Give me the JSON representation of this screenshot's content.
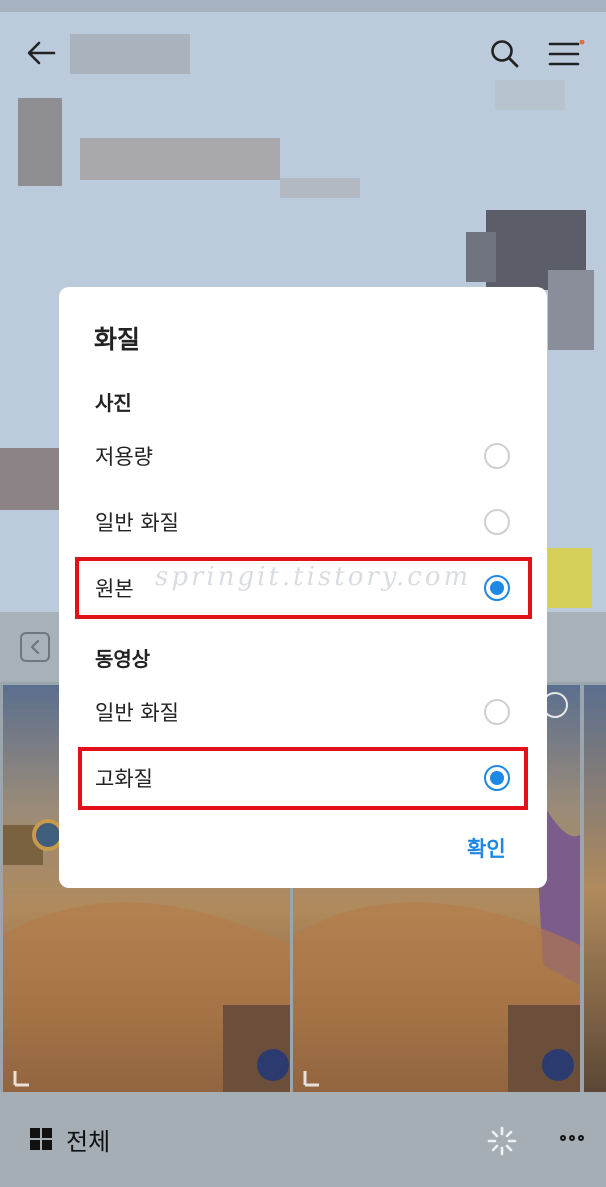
{
  "header": {
    "back_icon": "arrow-left-icon",
    "search_icon": "search-icon",
    "menu_icon": "hamburger-menu-icon",
    "notification_dot_color": "#e66a3c"
  },
  "dialog": {
    "title": "화질",
    "sections": [
      {
        "label": "사진",
        "options": [
          {
            "label": "저용량",
            "selected": false
          },
          {
            "label": "일반 화질",
            "selected": false
          },
          {
            "label": "원본",
            "selected": true
          }
        ]
      },
      {
        "label": "동영상",
        "options": [
          {
            "label": "일반 화질",
            "selected": false
          },
          {
            "label": "고화질",
            "selected": true
          }
        ]
      }
    ],
    "confirm_label": "확인",
    "accent_color": "#1e88e5"
  },
  "watermark": "springit.tistory.com",
  "bottom_bar": {
    "all_label": "전체",
    "grid_icon": "grid-icon",
    "more_icon": "more-icon"
  },
  "annotation_color": "#e3101a"
}
